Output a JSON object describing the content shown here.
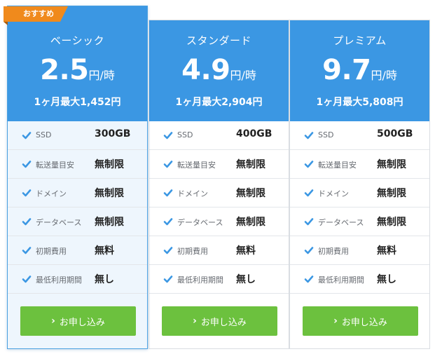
{
  "badge": "おすすめ",
  "cta_label": "お申し込み",
  "accent_color": "#3b97e3",
  "cta_color": "#6cc13e",
  "badge_color": "#f08a1c",
  "check_icon": "check-icon",
  "plans": [
    {
      "name": "ベーシック",
      "price": "2.5",
      "unit": "円/時",
      "capacity": "1ヶ月最大1,452円",
      "features": [
        {
          "label": "SSD",
          "value": "300GB"
        },
        {
          "label": "転送量目安",
          "value": "無制限"
        },
        {
          "label": "ドメイン",
          "value": "無制限"
        },
        {
          "label": "データベース",
          "value": "無制限"
        },
        {
          "label": "初期費用",
          "value": "無料"
        },
        {
          "label": "最低利用期間",
          "value": "無し"
        }
      ]
    },
    {
      "name": "スタンダード",
      "price": "4.9",
      "unit": "円/時",
      "capacity": "1ヶ月最大2,904円",
      "features": [
        {
          "label": "SSD",
          "value": "400GB"
        },
        {
          "label": "転送量目安",
          "value": "無制限"
        },
        {
          "label": "ドメイン",
          "value": "無制限"
        },
        {
          "label": "データベース",
          "value": "無制限"
        },
        {
          "label": "初期費用",
          "value": "無料"
        },
        {
          "label": "最低利用期間",
          "value": "無し"
        }
      ]
    },
    {
      "name": "プレミアム",
      "price": "9.7",
      "unit": "円/時",
      "capacity": "1ヶ月最大5,808円",
      "features": [
        {
          "label": "SSD",
          "value": "500GB"
        },
        {
          "label": "転送量目安",
          "value": "無制限"
        },
        {
          "label": "ドメイン",
          "value": "無制限"
        },
        {
          "label": "データベース",
          "value": "無制限"
        },
        {
          "label": "初期費用",
          "value": "無料"
        },
        {
          "label": "最低利用期間",
          "value": "無し"
        }
      ]
    }
  ]
}
